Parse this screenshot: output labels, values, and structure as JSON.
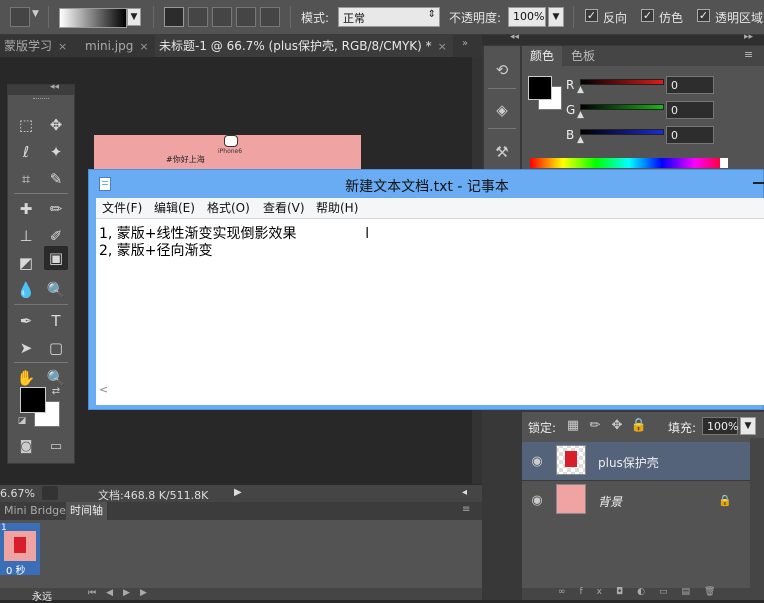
{
  "options_bar": {
    "mode_label": "模式:",
    "mode_value": "正常",
    "opacity_label": "不透明度:",
    "opacity_value": "100%",
    "reverse_label": "反向",
    "dither_label": "仿色",
    "transparency_label": "透明区域"
  },
  "doc_tabs": [
    {
      "label": "蒙版学习"
    },
    {
      "label": "mini.jpg"
    },
    {
      "label": "未标题-1 @ 66.7% (plus保护壳, RGB/8/CMYK) *"
    }
  ],
  "canvas": {
    "snippet_text": "#你好上海",
    "phone_text": "iPhone6"
  },
  "status_bar": {
    "zoom": "6.67%",
    "doc_info": "文档:468.8 K/511.8K"
  },
  "timeline": {
    "tabs": [
      "Mini Bridge",
      "时间轴"
    ],
    "frame_number": "1",
    "frame_delay": "0 秒",
    "loop_label": "永远"
  },
  "color_panel": {
    "tabs": [
      "颜色",
      "色板"
    ],
    "channels": [
      {
        "label": "R",
        "value": "0",
        "color": "#e01b1b"
      },
      {
        "label": "G",
        "value": "0",
        "color": "#1bb51b"
      },
      {
        "label": "B",
        "value": "0",
        "color": "#1b2bd8"
      }
    ]
  },
  "layers_panel": {
    "lock_label": "锁定:",
    "fill_label": "填充:",
    "fill_value": "100%",
    "layers": [
      {
        "name": "plus保护壳",
        "selected": true
      },
      {
        "name": "背景",
        "selected": false
      }
    ]
  },
  "notepad": {
    "title": "新建文本文档.txt - 记事本",
    "menu": [
      "文件(F)",
      "编辑(E)",
      "格式(O)",
      "查看(V)",
      "帮助(H)"
    ],
    "lines": [
      "1, 蒙版+线性渐变实现倒影效果",
      "2, 蒙版+径向渐变"
    ]
  },
  "colors": {
    "canvas_pink": "#f0a3a3",
    "accent_red": "#d81e2b",
    "notepad_blue": "#6aacf3"
  }
}
